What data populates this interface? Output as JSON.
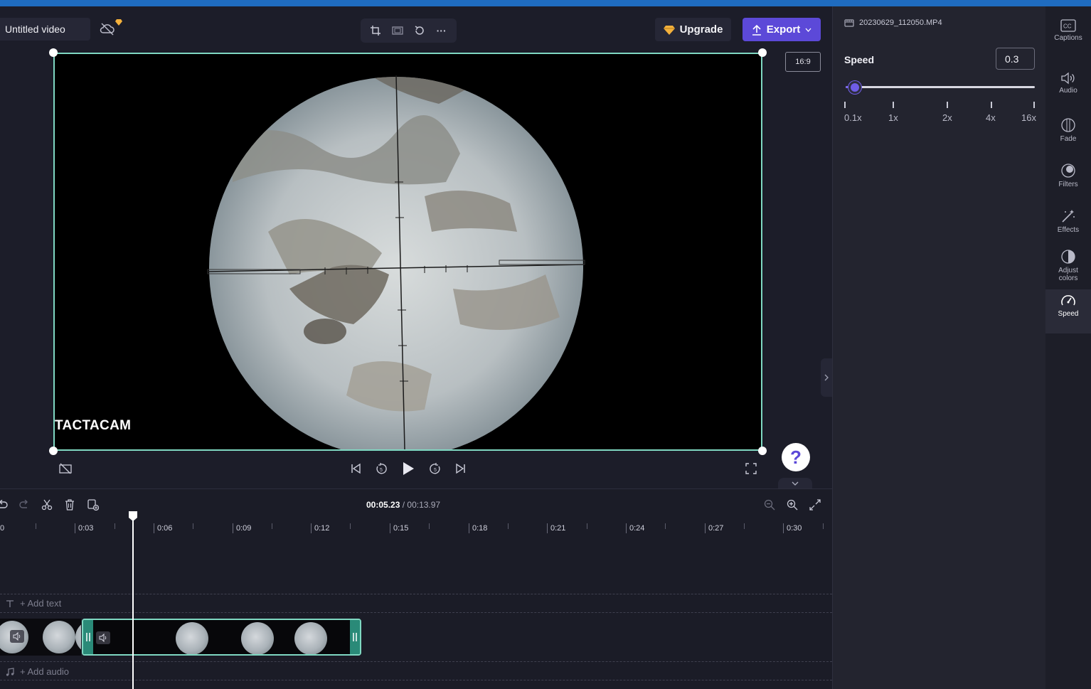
{
  "project": {
    "title": "Untitled video"
  },
  "header": {
    "toolbar_icons": [
      "crop-icon",
      "fit-icon",
      "rotate-icon",
      "more-icon"
    ],
    "more_glyph": "···",
    "upgrade_label": "Upgrade",
    "export_label": "Export",
    "aspect_ratio": "16:9"
  },
  "preview": {
    "watermark": "TACTACAM"
  },
  "help": {
    "glyph": "?"
  },
  "timeline": {
    "current_time": "00:05.23",
    "separator": " / ",
    "total_time": "00:13.97",
    "ruler_labels": [
      "0",
      "0:03",
      "0:06",
      "0:09",
      "0:12",
      "0:15",
      "0:18",
      "0:21",
      "0:24",
      "0:27",
      "0:30"
    ],
    "add_text": "+ Add text",
    "add_audio": "+ Add audio"
  },
  "panel": {
    "file_name": "20230629_112050.MP4",
    "speed_label": "Speed",
    "speed_value": "0.3",
    "speed_scale": [
      "0.1x",
      "1x",
      "2x",
      "4x",
      "16x"
    ]
  },
  "rail": {
    "items": [
      {
        "label": "Captions"
      },
      {
        "label": "Audio"
      },
      {
        "label": "Fade"
      },
      {
        "label": "Filters"
      },
      {
        "label": "Effects"
      },
      {
        "label": "Adjust colors"
      },
      {
        "label": "Speed",
        "active": true
      }
    ]
  },
  "colors": {
    "accent": "#5c49d8",
    "selection": "#7fd8c2",
    "topbar": "#1f6cc0"
  }
}
